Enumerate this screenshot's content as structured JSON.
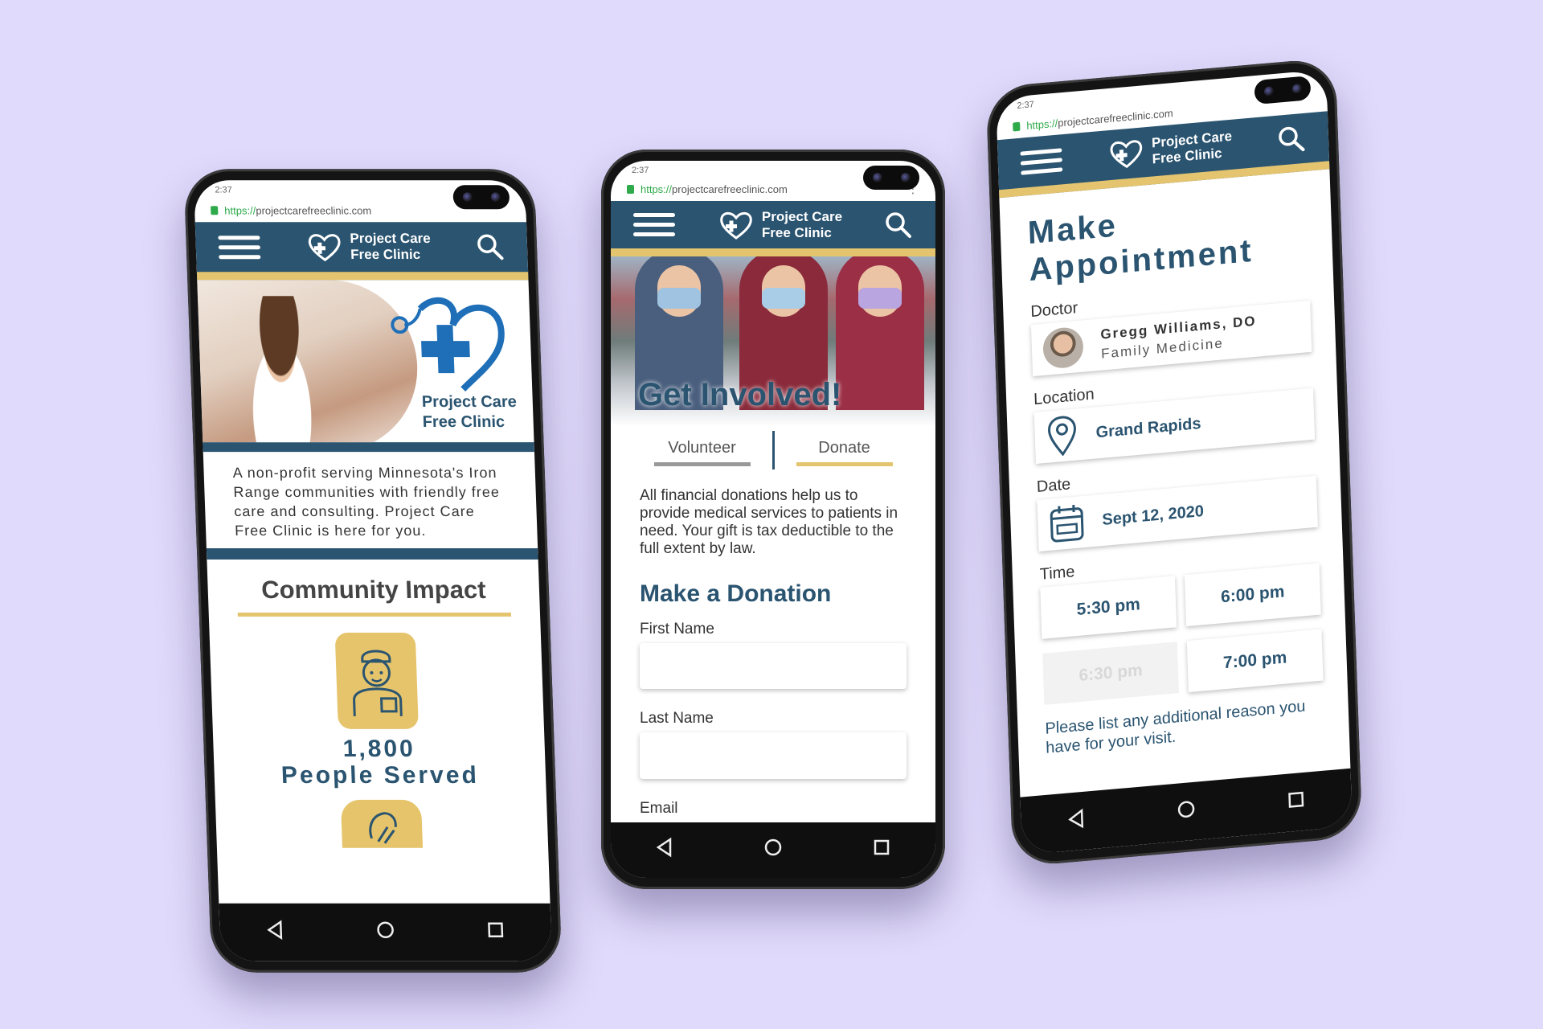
{
  "browser": {
    "time": "2:37",
    "url_scheme": "https://",
    "url_host": "projectcarefreeclinic.com"
  },
  "brand": {
    "name_line1": "Project Care",
    "name_line2": "Free Clinic",
    "hero_logo_line1": "Project Care",
    "hero_logo_line2": "Free Clinic"
  },
  "colors": {
    "primary": "#2a5470",
    "accent": "#e4c46e",
    "background": "#e0dafc"
  },
  "home": {
    "intro": "A non-profit serving Minnesota's Iron Range communities with friendly free care and consulting. Project Care Free Clinic is here for you.",
    "impact_title": "Community Impact",
    "stat_value": "1,800",
    "stat_label": "People Served"
  },
  "involved": {
    "hero_title": "Get Involved!",
    "tabs": [
      {
        "label": "Volunteer",
        "active": false
      },
      {
        "label": "Donate",
        "active": true
      }
    ],
    "donate_text": "All financial donations help us to provide medical services to patients in need. Your gift is tax deductible to the full extent by law.",
    "form_title": "Make a Donation",
    "fields": [
      {
        "label": "First Name",
        "value": ""
      },
      {
        "label": "Last Name",
        "value": ""
      },
      {
        "label": "Email",
        "value": ""
      }
    ]
  },
  "appointment": {
    "title_line1": "Make",
    "title_line2": "Appointment",
    "doctor_label": "Doctor",
    "doctor_name": "Gregg Williams, DO",
    "doctor_specialty": "Family Medicine",
    "location_label": "Location",
    "location_value": "Grand Rapids",
    "date_label": "Date",
    "date_value": "Sept 12, 2020",
    "time_label": "Time",
    "time_slots": [
      {
        "label": "5:30 pm",
        "available": true
      },
      {
        "label": "6:00 pm",
        "available": true
      },
      {
        "label": "6:30 pm",
        "available": false
      },
      {
        "label": "7:00 pm",
        "available": true
      }
    ],
    "reason_prompt": "Please list any additional reason you have for your visit."
  },
  "icons": {
    "menu": "hamburger-icon",
    "search": "search-icon",
    "back": "back-triangle-icon",
    "home": "home-circle-icon",
    "recents": "recents-square-icon",
    "location": "map-pin-icon",
    "date": "calendar-icon"
  }
}
